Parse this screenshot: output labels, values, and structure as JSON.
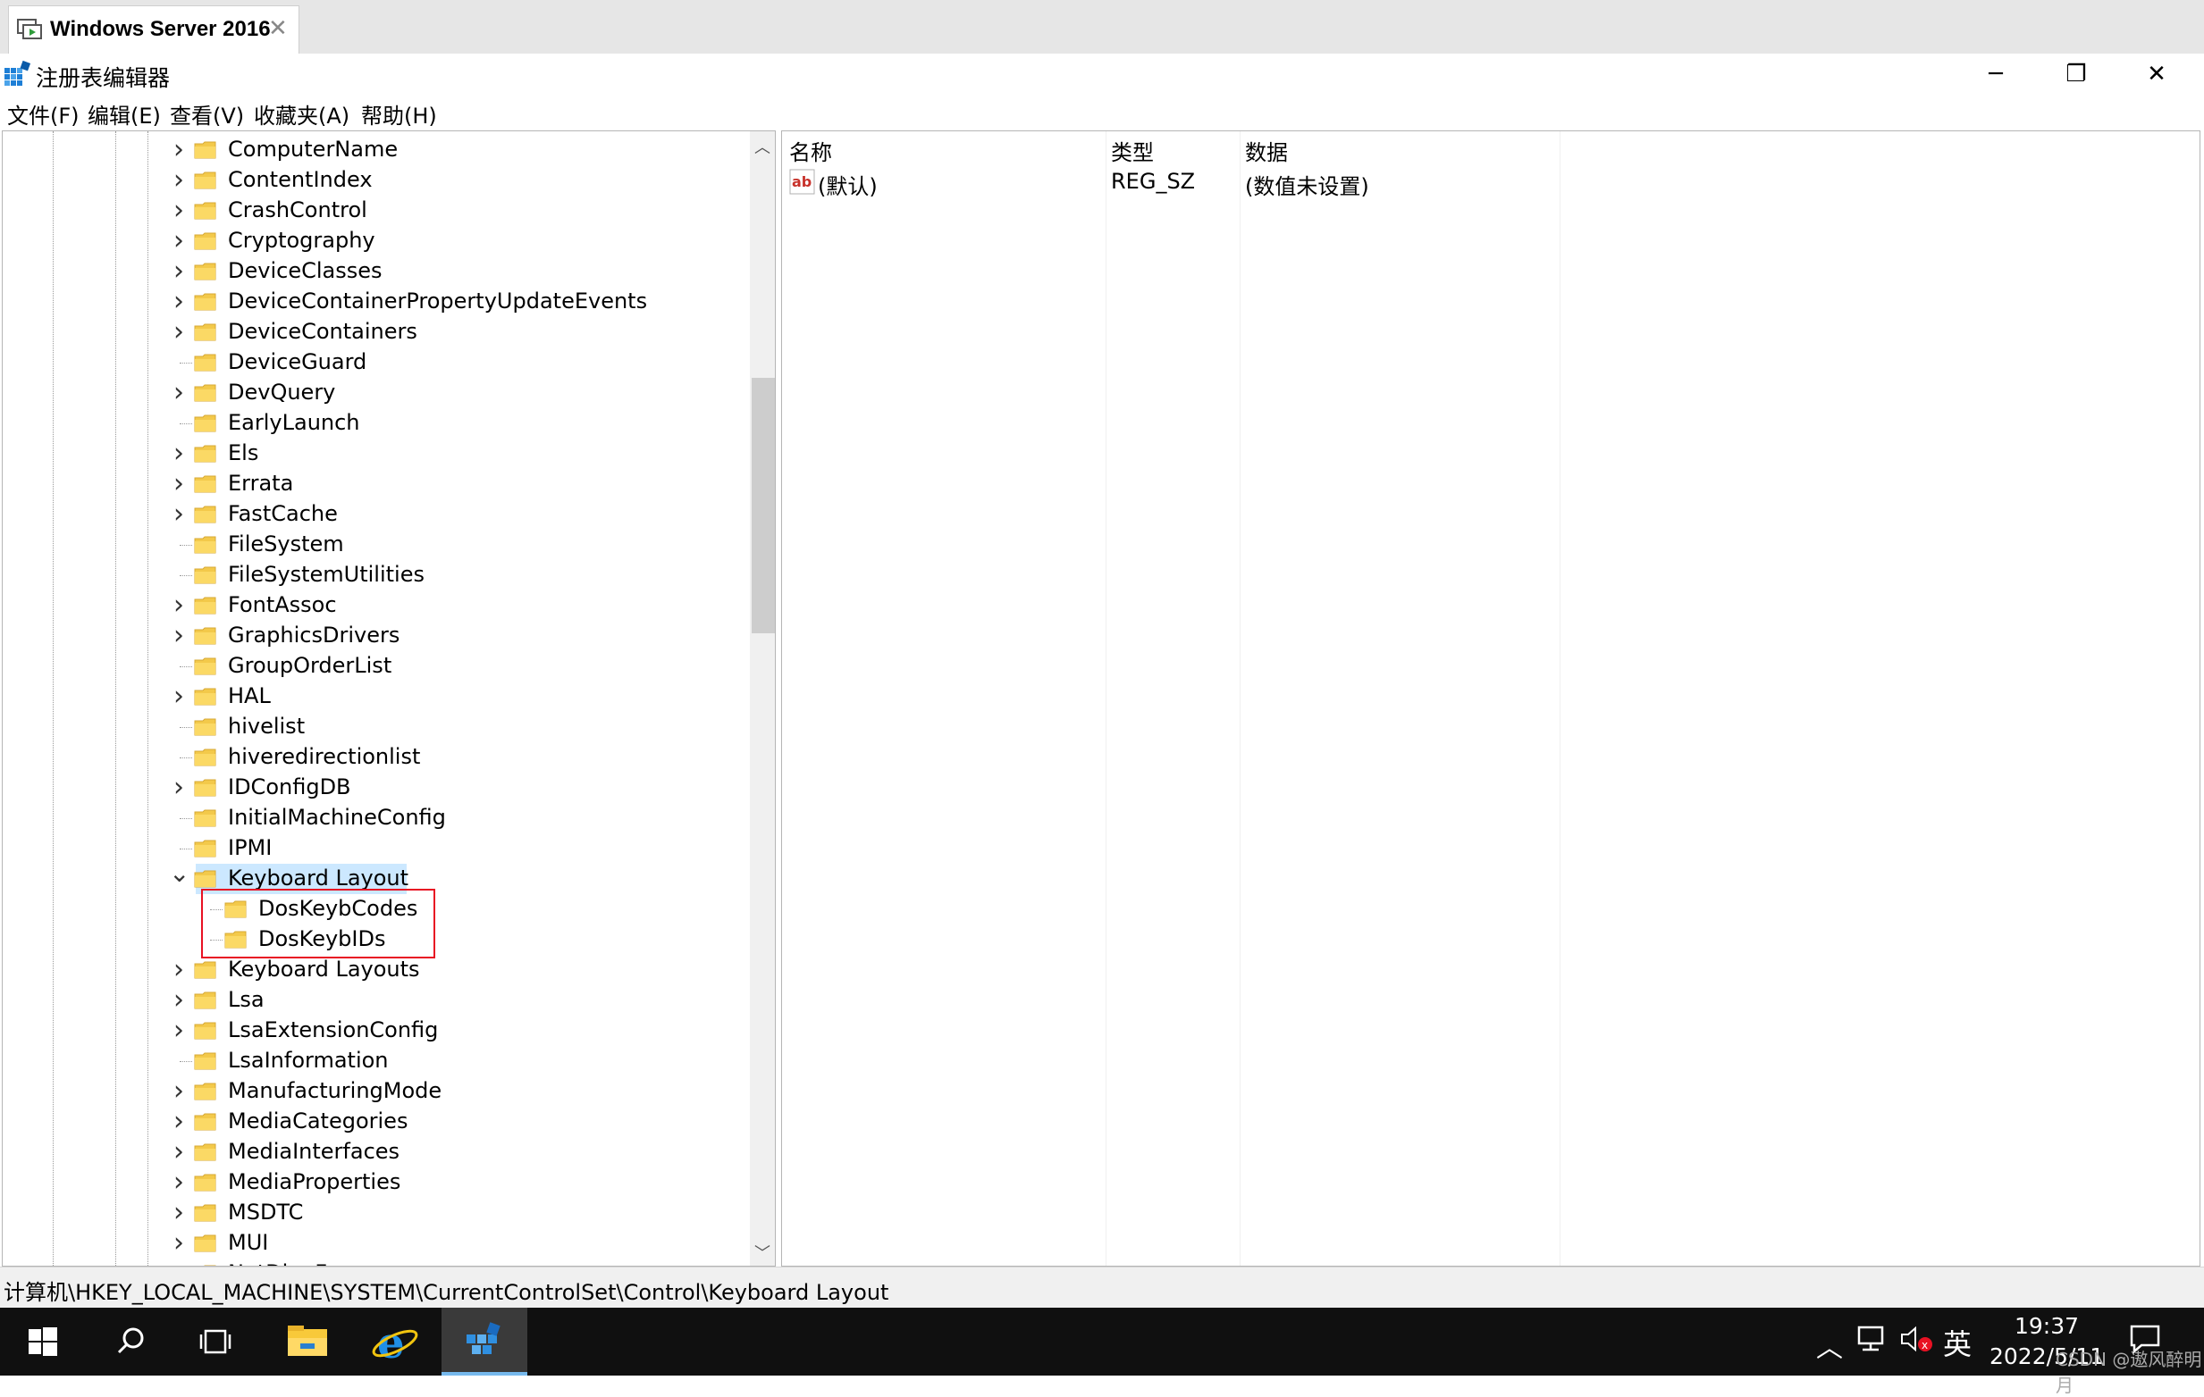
{
  "vm_tab": {
    "title": "Windows Server 2016",
    "close": "✕"
  },
  "window": {
    "title": "注册表编辑器",
    "minimize": "─",
    "maximize": "❐",
    "close": "✕"
  },
  "menu": [
    "文件(F)",
    "编辑(E)",
    "查看(V)",
    "收藏夹(A)",
    "帮助(H)"
  ],
  "tree": [
    {
      "label": "ComputerName",
      "expandable": true
    },
    {
      "label": "ContentIndex",
      "expandable": true
    },
    {
      "label": "CrashControl",
      "expandable": true
    },
    {
      "label": "Cryptography",
      "expandable": true
    },
    {
      "label": "DeviceClasses",
      "expandable": true
    },
    {
      "label": "DeviceContainerPropertyUpdateEvents",
      "expandable": true
    },
    {
      "label": "DeviceContainers",
      "expandable": true
    },
    {
      "label": "DeviceGuard",
      "expandable": false
    },
    {
      "label": "DevQuery",
      "expandable": true
    },
    {
      "label": "EarlyLaunch",
      "expandable": false
    },
    {
      "label": "Els",
      "expandable": true
    },
    {
      "label": "Errata",
      "expandable": true
    },
    {
      "label": "FastCache",
      "expandable": true
    },
    {
      "label": "FileSystem",
      "expandable": false
    },
    {
      "label": "FileSystemUtilities",
      "expandable": false
    },
    {
      "label": "FontAssoc",
      "expandable": true
    },
    {
      "label": "GraphicsDrivers",
      "expandable": true
    },
    {
      "label": "GroupOrderList",
      "expandable": false
    },
    {
      "label": "HAL",
      "expandable": true
    },
    {
      "label": "hivelist",
      "expandable": false
    },
    {
      "label": "hiveredirectionlist",
      "expandable": false
    },
    {
      "label": "IDConfigDB",
      "expandable": true
    },
    {
      "label": "InitialMachineConfig",
      "expandable": false
    },
    {
      "label": "IPMI",
      "expandable": false
    },
    {
      "label": "Keyboard Layout",
      "expandable": true,
      "expanded": true,
      "selected": true
    },
    {
      "label": "DosKeybCodes",
      "expandable": false,
      "child": true
    },
    {
      "label": "DosKeybIDs",
      "expandable": false,
      "child": true
    },
    {
      "label": "Keyboard Layouts",
      "expandable": true
    },
    {
      "label": "Lsa",
      "expandable": true
    },
    {
      "label": "LsaExtensionConfig",
      "expandable": true
    },
    {
      "label": "LsaInformation",
      "expandable": false
    },
    {
      "label": "ManufacturingMode",
      "expandable": true
    },
    {
      "label": "MediaCategories",
      "expandable": true
    },
    {
      "label": "MediaInterfaces",
      "expandable": true
    },
    {
      "label": "MediaProperties",
      "expandable": true
    },
    {
      "label": "MSDTC",
      "expandable": true
    },
    {
      "label": "MUI",
      "expandable": true
    },
    {
      "label": "NetDiagFx",
      "expandable": true
    }
  ],
  "list": {
    "headers": {
      "name": "名称",
      "type": "类型",
      "data": "数据"
    },
    "rows": [
      {
        "name": "(默认)",
        "type": "REG_SZ",
        "data": "(数值未设置)",
        "icon": "string-value-icon"
      }
    ]
  },
  "status": {
    "path": "计算机\\HKEY_LOCAL_MACHINE\\SYSTEM\\CurrentControlSet\\Control\\Keyboard Layout"
  },
  "taskbar": {
    "ime": "英",
    "time": "19:37",
    "date": "2022/5/11",
    "watermark": "CSDN @遨风醉明月"
  },
  "colors": {
    "selection": "#cce8ff",
    "highlight_box": "#e81123",
    "taskbar": "#101010"
  }
}
